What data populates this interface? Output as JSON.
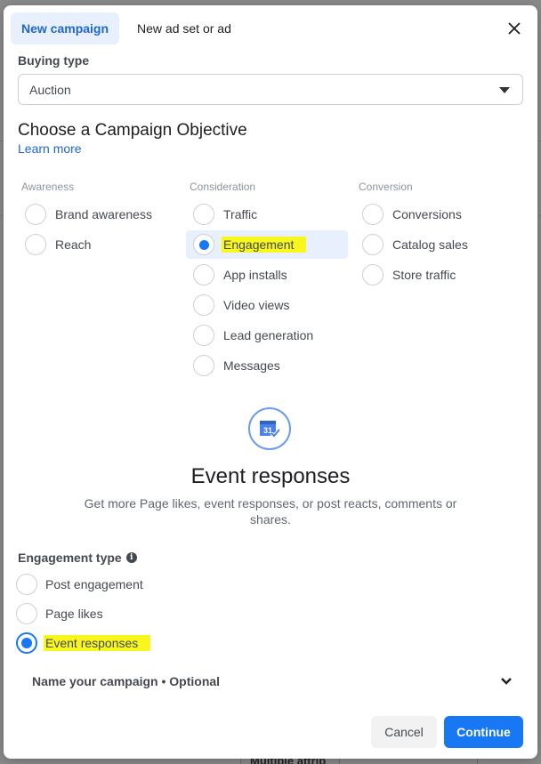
{
  "tabs": [
    {
      "label": "New campaign",
      "active": true
    },
    {
      "label": "New ad set or ad",
      "active": false
    }
  ],
  "buying_type": {
    "label": "Buying type",
    "value": "Auction"
  },
  "objective": {
    "heading": "Choose a Campaign Objective",
    "learn_more": "Learn more",
    "columns": [
      {
        "title": "Awareness",
        "options": [
          "Brand awareness",
          "Reach"
        ]
      },
      {
        "title": "Consideration",
        "options": [
          "Traffic",
          "Engagement",
          "App installs",
          "Video views",
          "Lead generation",
          "Messages"
        ]
      },
      {
        "title": "Conversion",
        "options": [
          "Conversions",
          "Catalog sales",
          "Store traffic"
        ]
      }
    ],
    "selected": "Engagement"
  },
  "detail": {
    "icon": "calendar-check-icon",
    "icon_day": "31",
    "title": "Event responses",
    "description": "Get more Page likes, event responses, or post reacts, comments or shares."
  },
  "engagement_type": {
    "label": "Engagement type",
    "options": [
      "Post engagement",
      "Page likes",
      "Event responses"
    ],
    "selected": "Event responses"
  },
  "name_campaign": {
    "label": "Name your campaign • Optional"
  },
  "footer": {
    "cancel": "Cancel",
    "continue": "Continue"
  },
  "background": {
    "cell_text": "Multiple attrib"
  },
  "colors": {
    "accent": "#1877f2",
    "highlight": "#f7f71e",
    "selected_bg": "#e7f0fc"
  }
}
